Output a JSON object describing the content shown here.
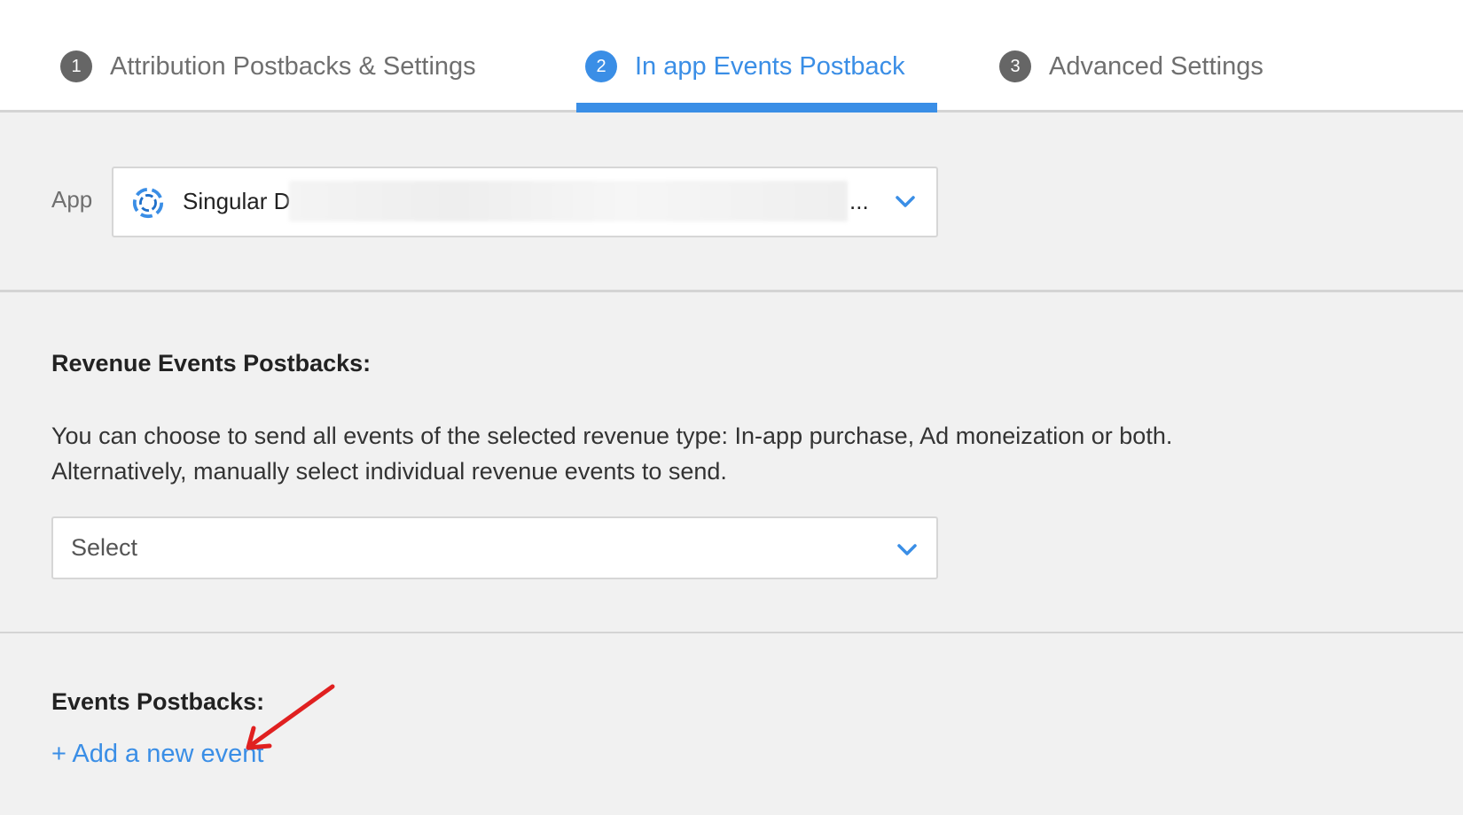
{
  "tabs": [
    {
      "number": "1",
      "label": "Attribution Postbacks & Settings"
    },
    {
      "number": "2",
      "label": "In app Events Postback"
    },
    {
      "number": "3",
      "label": "Advanced Settings"
    }
  ],
  "app": {
    "label": "App",
    "selected_value": "Singular D",
    "truncation": "...",
    "icon": "singular-logo-icon"
  },
  "revenue": {
    "title": "Revenue Events Postbacks:",
    "description_line1": "You can choose to send all events of the selected revenue type: In-app purchase, Ad moneization or both.",
    "description_line2": "Alternatively, manually select individual revenue events to send.",
    "select_placeholder": "Select"
  },
  "events": {
    "title": "Events Postbacks:",
    "add_link": "+ Add a new event"
  },
  "colors": {
    "accent": "#3a8ee6",
    "inactive_tab": "#6f6f6f",
    "annotation": "#e02020"
  }
}
